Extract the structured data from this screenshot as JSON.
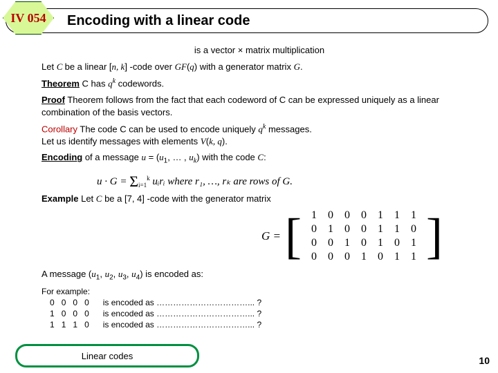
{
  "header": {
    "badge": "IV 054",
    "title": "Encoding with  a linear code"
  },
  "intro": {
    "line1": "is a vector × matrix multiplication",
    "line2_a": "Let ",
    "line2_b": "C ",
    "line2_c": "be a linear  [",
    "line2_d": "n, k",
    "line2_e": "] -code over ",
    "line2_f": "GF",
    "line2_g": "(",
    "line2_h": "q",
    "line2_i": ") with a generator matrix ",
    "line2_j": "G",
    "line2_k": "."
  },
  "theorem": {
    "label": "Theorem",
    "body_a": " C has ",
    "body_b": "q",
    "body_c": "k",
    "body_d": " codewords."
  },
  "proof": {
    "label": "Proof",
    "body": " Theorem follows from the fact that each codeword of C can be expressed uniquely as a linear combination of the basis vectors."
  },
  "corollary": {
    "label": "Corollary",
    "body_a": " The code C can be used to encode uniquely ",
    "body_b": "q",
    "body_c": "k",
    "body_d": " messages.",
    "line2_a": "Let us identify messages with elements ",
    "line2_b": "V",
    "line2_c": "(",
    "line2_d": "k, q",
    "line2_e": ")."
  },
  "encoding": {
    "label": "Encoding",
    "a": " of a message ",
    "b": "u",
    "c": " = (",
    "d": "u",
    "e": "1",
    "f": ", … , ",
    "g": "u",
    "h": "k",
    "i": ") with the code ",
    "j": "C",
    "k": ":"
  },
  "formula": {
    "lhs": "u · G = ",
    "sum": "Σ",
    "sub": "i=1",
    "sup": "k",
    "mid": " uᵢrᵢ  where  r₁, …, rₖ are rows of G."
  },
  "example": {
    "label": "Example",
    "a": " Let ",
    "b": "C",
    "c": " be a [7, 4] -code with the generator matrix"
  },
  "matrix": {
    "lhs": "G =",
    "rows": [
      [
        "1",
        "0",
        "0",
        "0",
        "1",
        "1",
        "1"
      ],
      [
        "0",
        "1",
        "0",
        "0",
        "1",
        "1",
        "0"
      ],
      [
        "0",
        "0",
        "1",
        "0",
        "1",
        "0",
        "1"
      ],
      [
        "0",
        "0",
        "0",
        "1",
        "0",
        "1",
        "1"
      ]
    ]
  },
  "msgline": {
    "a": "A message (",
    "b": "u",
    "c": "1",
    "d": ", ",
    "e": "u",
    "f": "2",
    "g": ", ",
    "h": "u",
    "i": "3",
    "j": ", ",
    "k": "u",
    "l": "4",
    "m": ") is encoded as:"
  },
  "examples": {
    "head": "For example:",
    "rows": [
      {
        "w": [
          "0",
          "0",
          "0",
          "0"
        ],
        "txt": "is encoded as ……………………………... ?"
      },
      {
        "w": [
          "1",
          "0",
          "0",
          "0"
        ],
        "txt": "is encoded as ……………………………... ?"
      },
      {
        "w": [
          "1",
          "1",
          "1",
          "0"
        ],
        "txt": "is encoded as ……………………………... ?"
      }
    ]
  },
  "footer": {
    "label": "Linear codes",
    "page": "10"
  }
}
